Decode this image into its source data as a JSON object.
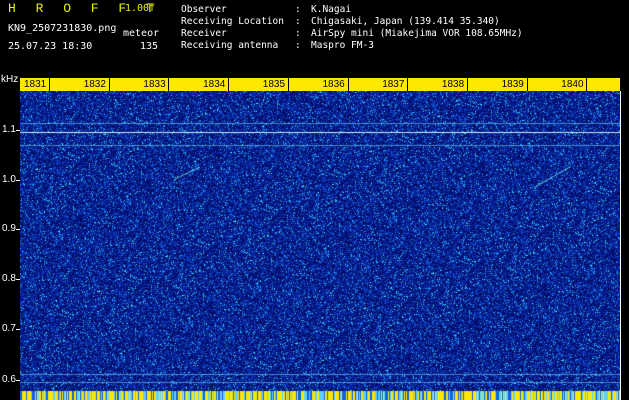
{
  "header": {
    "app_title": "H R O F F T",
    "version": "1.00f",
    "file_name": "KN9_2507231830.png",
    "date_time": "25.07.23 18:30",
    "meteor_label": "meteor",
    "meteor_count": "135"
  },
  "info": {
    "observer_key": "Observer",
    "observer_val": "K.Nagai",
    "location_key": "Receiving Location",
    "location_val": "Chigasaki, Japan (139.414 35.340)",
    "receiver_key": "Receiver",
    "receiver_val": "AirSpy mini (Miakejima VOR 108.65MHz)",
    "antenna_key": "Receiving antenna",
    "antenna_val": "Maspro FM-3",
    "sep": ":"
  },
  "axis": {
    "y_unit": "kHz",
    "y_ticks": [
      "1.1",
      "1.0",
      "0.9",
      "0.8",
      "0.7",
      "0.6"
    ],
    "x_ticks": [
      "1831",
      "1832",
      "1833",
      "1834",
      "1835",
      "1836",
      "1837",
      "1838",
      "1839",
      "1840"
    ]
  },
  "colors": {
    "background": "#000000",
    "title": "#e8f000",
    "time_bar": "#ffe800",
    "noise_base": "#0a1a8c",
    "noise_hot": "#20d0ff"
  }
}
